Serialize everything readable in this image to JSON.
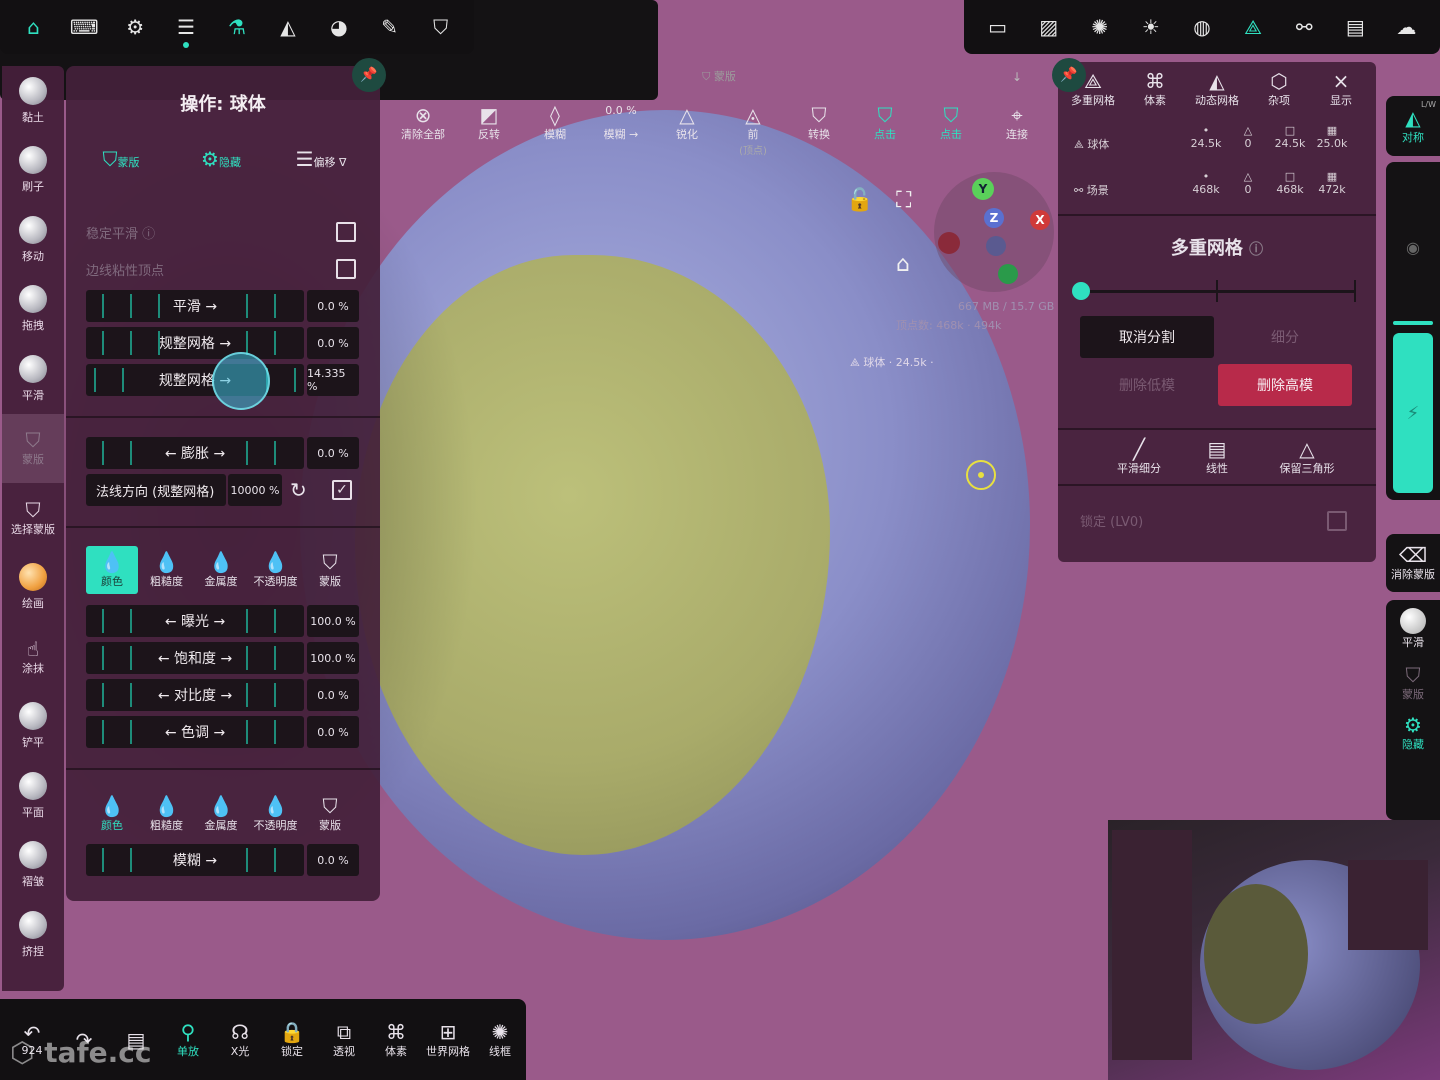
{
  "top_left_bar": [
    "home-icon",
    "keyboard-icon",
    "settings-icon",
    "layers-icon",
    "flask-icon",
    "scene-icon",
    "palette-icon",
    "brush-icon",
    "shield-icon"
  ],
  "top_right_bar": [
    "camera-icon",
    "image-icon",
    "aperture-icon",
    "sun-icon",
    "globe-icon",
    "mesh-icon",
    "share-icon",
    "folder-icon",
    "wide-icon"
  ],
  "left_tools": [
    {
      "label": "黏土"
    },
    {
      "label": "刷子"
    },
    {
      "label": "移动"
    },
    {
      "label": "拖拽"
    },
    {
      "label": "平滑"
    },
    {
      "label": "蒙版"
    },
    {
      "label": "选择蒙版"
    },
    {
      "label": "绘画"
    },
    {
      "label": "涂抹"
    },
    {
      "label": "铲平"
    },
    {
      "label": "平面"
    },
    {
      "label": "褶皱"
    },
    {
      "label": "挤捏"
    }
  ],
  "op_panel": {
    "title": "操作: 球体",
    "tabs": [
      "蒙版",
      "隐藏",
      "偏移"
    ],
    "stable_smooth": "稳定平滑",
    "edge_sticky": "边线粘性顶点",
    "sliders": [
      {
        "label": "平滑 →",
        "value": "0.0 %"
      },
      {
        "label": "规整网格 →",
        "value": "0.0 %"
      },
      {
        "label": "规整网格 →",
        "value": "14.335 %"
      },
      {
        "label": "← 膨胀 →",
        "value": "0.0 %"
      }
    ],
    "normal_dir": "法线方向 (规整网格)",
    "normal_val": "10000 %",
    "channels": [
      "颜色",
      "粗糙度",
      "金属度",
      "不透明度",
      "蒙版"
    ],
    "color_sliders": [
      {
        "label": "← 曝光 →",
        "value": "100.0 %"
      },
      {
        "label": "← 饱和度 →",
        "value": "100.0 %"
      },
      {
        "label": "← 对比度 →",
        "value": "0.0 %"
      },
      {
        "label": "← 色调 →",
        "value": "0.0 %"
      }
    ],
    "channels2": [
      "颜色",
      "粗糙度",
      "金属度",
      "不透明度",
      "蒙版"
    ],
    "blur": {
      "label": "模糊 →",
      "value": "0.0 %"
    }
  },
  "mask_bar": {
    "title": "蒙版",
    "items": [
      {
        "label": "清除全部",
        "icon": "clear-icon"
      },
      {
        "label": "反转",
        "icon": "invert-icon"
      },
      {
        "label": "模糊",
        "icon": "drop-icon"
      },
      {
        "label": "模糊 →",
        "value": "0.0 %"
      },
      {
        "label": "锐化",
        "icon": "sharpen-icon"
      },
      {
        "label": "前",
        "sub": "(顶点)",
        "icon": "eye-icon"
      },
      {
        "label": "转换",
        "icon": "convert-icon"
      },
      {
        "label": "点击",
        "icon": "click-icon"
      },
      {
        "label": "点击",
        "icon": "click2-icon"
      },
      {
        "label": "连接",
        "icon": "connect-icon"
      }
    ]
  },
  "viewport": {
    "memory": "667 MB / 15.7 GB",
    "verts": "顶点数: 468k · 494k",
    "mesh_info": "球体 · 24.5k · ",
    "axes": [
      "Y",
      "Z",
      "X"
    ]
  },
  "right_panel": {
    "tabs": [
      "多重网格",
      "体素",
      "动态网格",
      "杂项",
      "显示"
    ],
    "rows": [
      {
        "name": "球体",
        "v": [
          "24.5k",
          "0",
          "24.5k",
          "25.0k"
        ]
      },
      {
        "name": "场景",
        "v": [
          "468k",
          "0",
          "468k",
          "472k"
        ]
      }
    ],
    "title": "多重网格",
    "unsubdivide": "取消分割",
    "subdivide": "细分",
    "del_low": "删除低模",
    "del_high": "删除高模",
    "footer_tabs": [
      "平滑细分",
      "线性",
      "保留三角形"
    ],
    "lock": "锁定 (LV0)"
  },
  "right_bar": {
    "sym": "对称",
    "sym_badge": "L/W",
    "clear_mask": "消除蒙版",
    "smooth": "平滑",
    "mask": "蒙版",
    "hide": "隐藏"
  },
  "bottom_bar": [
    {
      "label": "924",
      "icon": "undo-icon"
    },
    {
      "label": "",
      "icon": "redo-icon"
    },
    {
      "label": "",
      "icon": "notes-icon"
    },
    {
      "label": "单放",
      "icon": "pick-icon"
    },
    {
      "label": "X光",
      "icon": "xray-icon"
    },
    {
      "label": "锁定",
      "icon": "lock-icon"
    },
    {
      "label": "透视",
      "icon": "persp-icon"
    },
    {
      "label": "体素",
      "icon": "voxel-icon"
    },
    {
      "label": "世界网格",
      "icon": "grid-icon"
    },
    {
      "label": "线框",
      "icon": "wire-icon"
    }
  ],
  "watermark": "tafe.cc"
}
